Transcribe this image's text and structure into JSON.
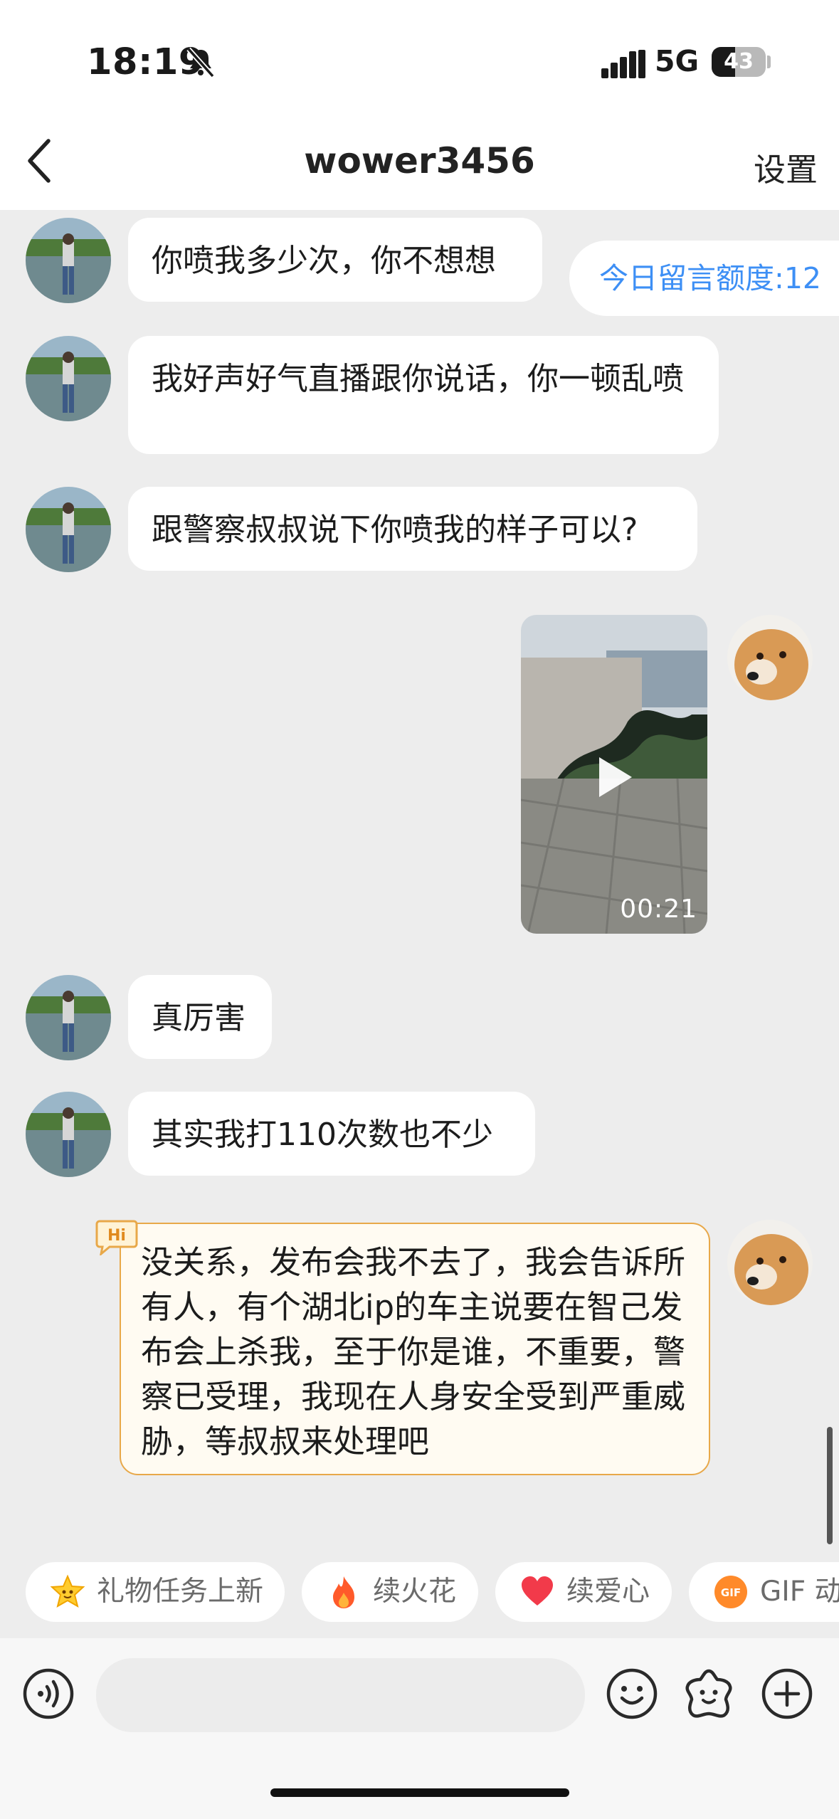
{
  "status_bar": {
    "time": "18:19",
    "network": "5G",
    "battery": "43"
  },
  "nav": {
    "title": "wower3456",
    "settings_label": "设置"
  },
  "quota_label": "今日留言额度:12",
  "messages": [
    {
      "side": "left",
      "text": "你喷我多少次，你不想想"
    },
    {
      "side": "left",
      "text": "我好声好气直播跟你说话，你一顿乱喷"
    },
    {
      "side": "left",
      "text": "跟警察叔叔说下你喷我的样子可以?"
    },
    {
      "side": "right",
      "type": "video",
      "duration": "00:21"
    },
    {
      "side": "left",
      "text": "真厉害"
    },
    {
      "side": "left",
      "text": "其实我打110次数也不少"
    },
    {
      "side": "right",
      "text": "没关系，发布会我不去了，我会告诉所有人，有个湖北ip的车主说要在智己发布会上杀我，至于你是谁，不重要，警察已受理，我现在人身安全受到严重威胁，等叔叔来处理吧",
      "badge": "Hi"
    }
  ],
  "quick_actions": [
    {
      "label": "礼物任务上新",
      "icon": "star-face-icon"
    },
    {
      "label": "续火花",
      "icon": "fire-icon"
    },
    {
      "label": "续爱心",
      "icon": "heart-icon"
    },
    {
      "label": "GIF 动",
      "icon": "gif-icon",
      "icon_text": "GIF"
    }
  ],
  "colors": {
    "accent_blue": "#3d8ff5",
    "hi_border": "#e8a849",
    "hi_bg": "#fffbf2",
    "fire": "#ff5a2a",
    "heart": "#f23a4a"
  }
}
